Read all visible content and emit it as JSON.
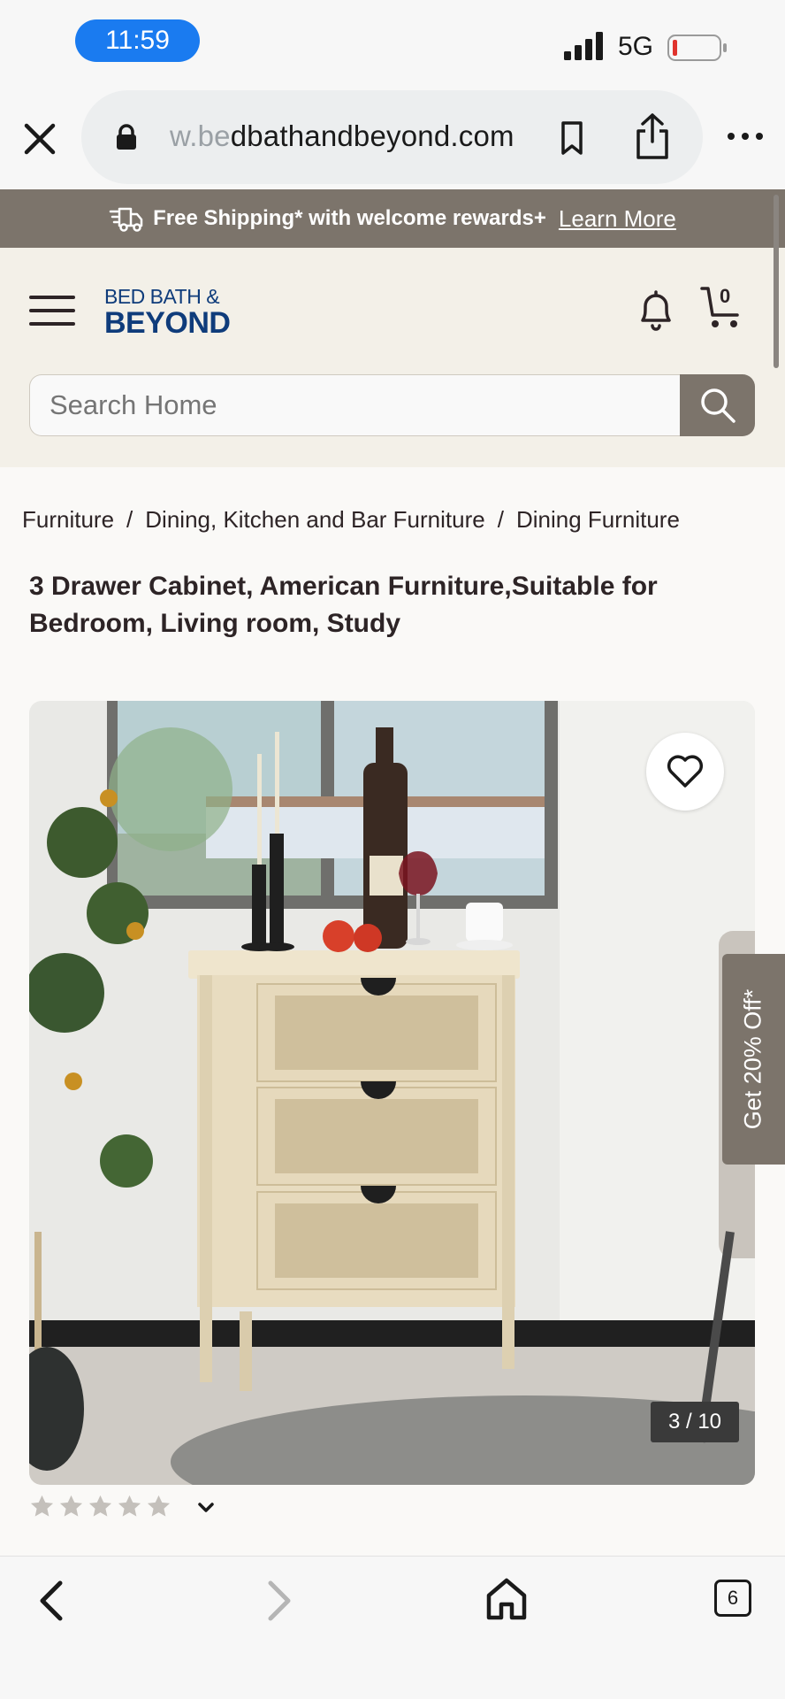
{
  "status_bar": {
    "time": "11:59",
    "network": "5G"
  },
  "browser": {
    "url_faded": "w.be",
    "url_main": "dbathandbeyond.com"
  },
  "promo": {
    "text": "Free Shipping* with welcome rewards+",
    "link": "Learn More"
  },
  "header": {
    "logo_top": "BED BATH &",
    "logo_bottom": "BEYOND",
    "cart_count": "0",
    "search_placeholder": "Search Home"
  },
  "breadcrumb": [
    "Furniture",
    "Dining, Kitchen and Bar Furniture",
    "Dining Furniture"
  ],
  "product": {
    "title": "3 Drawer Cabinet, American Furniture,Suitable for Bedroom, Living room, Study",
    "image_counter": "3 / 10",
    "rating_stars": 0,
    "rating_max": 5
  },
  "side_tab": "Get 20% Off*",
  "toolbar": {
    "tabs_count": "6"
  },
  "colors": {
    "brand_blue": "#0f3c7b",
    "banner_taupe": "#7c746b",
    "header_bg": "#f3f0e8",
    "status_pill": "#1a7bf0"
  }
}
